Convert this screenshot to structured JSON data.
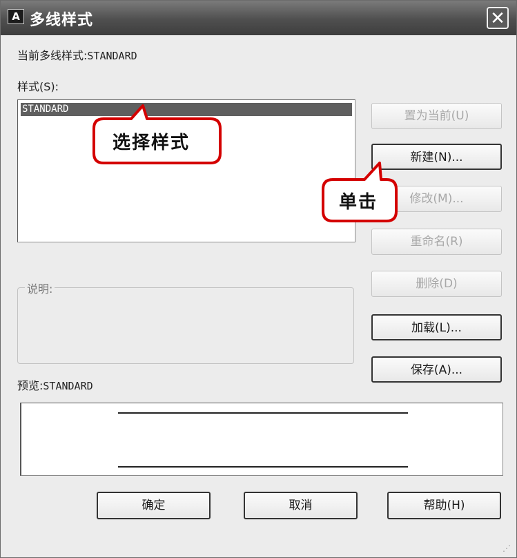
{
  "window": {
    "title": "多线样式",
    "app_icon_letter": "A",
    "close_glyph": "✕"
  },
  "current_style": {
    "label": "当前多线样式:",
    "value": "STANDARD"
  },
  "styles": {
    "label": "样式(S):",
    "items": [
      "STANDARD"
    ],
    "selected": "STANDARD"
  },
  "buttons": {
    "set_current": "置为当前(U)",
    "new": "新建(N)...",
    "modify": "修改(M)...",
    "rename": "重命名(R)",
    "delete": "删除(D)",
    "load": "加载(L)...",
    "save": "保存(A)..."
  },
  "description": {
    "label": "说明:"
  },
  "preview": {
    "label": "预览:",
    "value": "STANDARD"
  },
  "footer": {
    "ok": "确定",
    "cancel": "取消",
    "help": "帮助(H)"
  },
  "annotations": {
    "select_style": "选择样式",
    "click": "单击",
    "color": "#d40000"
  }
}
